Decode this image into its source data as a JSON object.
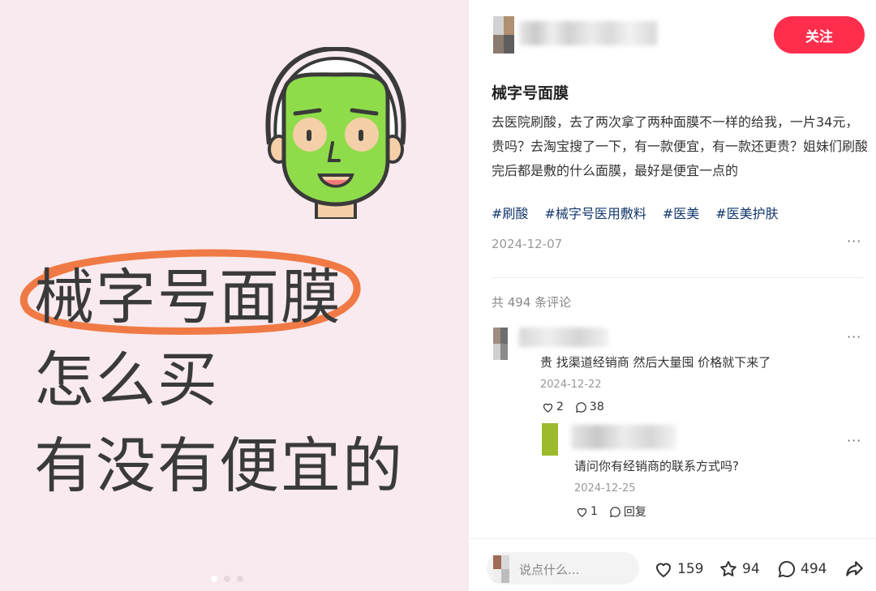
{
  "poster": {
    "line1": "械字号面膜",
    "line2": "怎么买",
    "line3": "有没有便宜的",
    "slide_count": 3,
    "active_slide": 1
  },
  "author": {
    "follow_label": "关注"
  },
  "note": {
    "title": "械字号面膜",
    "body": "去医院刷酸，去了两次拿了两种面膜不一样的给我，一片34元，贵吗？去淘宝搜了一下，有一款便宜，有一款还更贵？姐妹们刷酸完后都是敷的什么面膜，最好是便宜一点的",
    "tags": [
      "#刷酸",
      "#械字号医用敷料",
      "#医美",
      "#医美护肤"
    ],
    "date": "2024-12-07",
    "more": "···"
  },
  "comments": {
    "count_label": "共 494 条评论",
    "items": [
      {
        "text": "贵 找渠道经销商 然后大量囤 价格就下来了",
        "date": "2024-12-22",
        "likes": "2",
        "replies": "38",
        "more": "···"
      },
      {
        "text": "请问你有经销商的联系方式吗?",
        "date": "2024-12-25",
        "likes": "1",
        "reply_label": "回复",
        "more": "···"
      }
    ]
  },
  "bottom": {
    "input_placeholder": "说点什么...",
    "likes": "159",
    "stars": "94",
    "comments": "494"
  },
  "colors": {
    "accent": "#ff2e4d",
    "tag": "#13386c",
    "poster_bg": "#f8eaee",
    "mask_green": "#8fdc4a",
    "ring_orange": "#f07a45"
  }
}
